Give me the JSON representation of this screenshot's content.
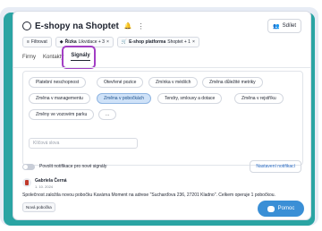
{
  "header": {
    "title": "E-shopy na Shoptet",
    "share_label": "Sdílet"
  },
  "filters": {
    "filter_label": "Filtrovat",
    "chip1_key": "Řízka",
    "chip1_value": "Likvidace + 3",
    "chip2_key": "E-shop platforma",
    "chip2_value": "Shoptet + 1"
  },
  "tabs": [
    "Firmy",
    "Kontakty",
    "Signály"
  ],
  "signals": {
    "pills": [
      "Platební neschopnost",
      "Otevřené pozice",
      "Zmínka v médiích",
      "Změna důležité metriky",
      "Změna v managementu",
      "Změna v pobočkách",
      "Tendry, smlouvy a dotace",
      "Změna v rejstříku",
      "Změny ve vozovém parku",
      "..."
    ],
    "active": "Změna v pobočkách",
    "keyword_placeholder": "Klíčová slova"
  },
  "notifications": {
    "toggle_label": "Povolit notifikace pro nové signály",
    "settings_button": "Nastavení notifikací"
  },
  "feed": {
    "author": "Gabriela Černá",
    "date": "1. 10. 2024",
    "text": "Společnost založila novou pobočku Kavárna Moment na adrese \"Sucharďova 236, 27201 Kladno\". Celkem operuje 1 pobočkou.",
    "tag": "Nová pobočka"
  },
  "help": {
    "label": "Pomoc"
  },
  "colors": {
    "accent": "#3a8fd6",
    "active_pill_bg": "#cfe2f8",
    "highlight_ring": "#a23ec4",
    "teal_bg": "#2aa4a3"
  }
}
